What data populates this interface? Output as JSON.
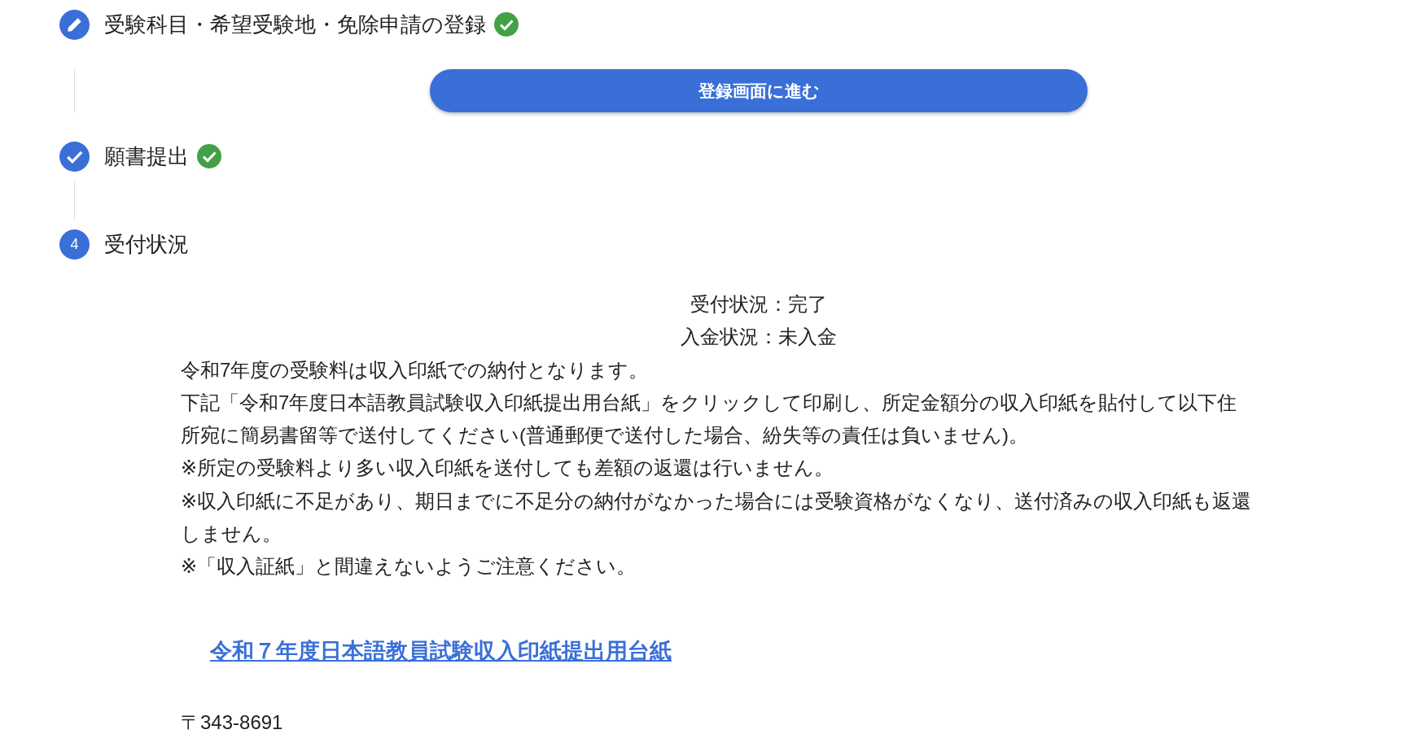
{
  "steps": [
    {
      "kind": "edit",
      "title": "受験科目・希望受験地・免除申請の登録",
      "completed": true,
      "button": "登録画面に進む"
    },
    {
      "kind": "done",
      "title": "願書提出",
      "completed": true
    },
    {
      "kind": "number",
      "number": "4",
      "title": "受付状況",
      "completed": false,
      "status_lines": [
        "受付状況：完了",
        "入金状況：未入金"
      ],
      "paragraphs": [
        "令和7年度の受験料は収入印紙での納付となります。",
        "下記「令和7年度日本語教員試験収入印紙提出用台紙」をクリックして印刷し、所定金額分の収入印紙を貼付して以下住所宛に簡易書留等で送付してください(普通郵便で送付した場合、紛失等の責任は負いません)。",
        "※所定の受験料より多い収入印紙を送付しても差額の返還は行いません。",
        "※収入印紙に不足があり、期日までに不足分の納付がなかった場合には受験資格がなくなり、送付済みの収入印紙も返還しません。",
        "※「収入証紙」と間違えないようご注意ください。"
      ],
      "link": "令和７年度日本語教員試験収入印紙提出用台紙",
      "postal": "〒343-8691"
    }
  ]
}
